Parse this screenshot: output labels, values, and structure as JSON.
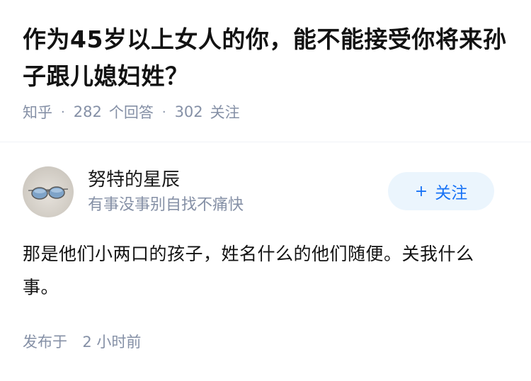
{
  "question": {
    "title": "作为45岁以上女人的你，能不能接受你将来孙子跟儿媳妇姓？",
    "source": "知乎",
    "answer_count": "282",
    "answer_label": "个回答",
    "follower_count": "302",
    "follower_label": "关注"
  },
  "answer": {
    "author_name": "努特的星辰",
    "author_bio": "有事没事别自找不痛快",
    "follow_label": "关注",
    "content": "那是他们小两口的孩子，姓名什么的他们随便。关我什么事。",
    "published_prefix": "发布于",
    "published_time": "2 小时前"
  },
  "colors": {
    "accent": "#1772f6",
    "follow_bg": "#ebf5fd",
    "meta_gray": "#8590a6",
    "text": "#121212"
  },
  "icons": {
    "avatar": "sunglasses-avatar",
    "plus": "plus-icon"
  }
}
